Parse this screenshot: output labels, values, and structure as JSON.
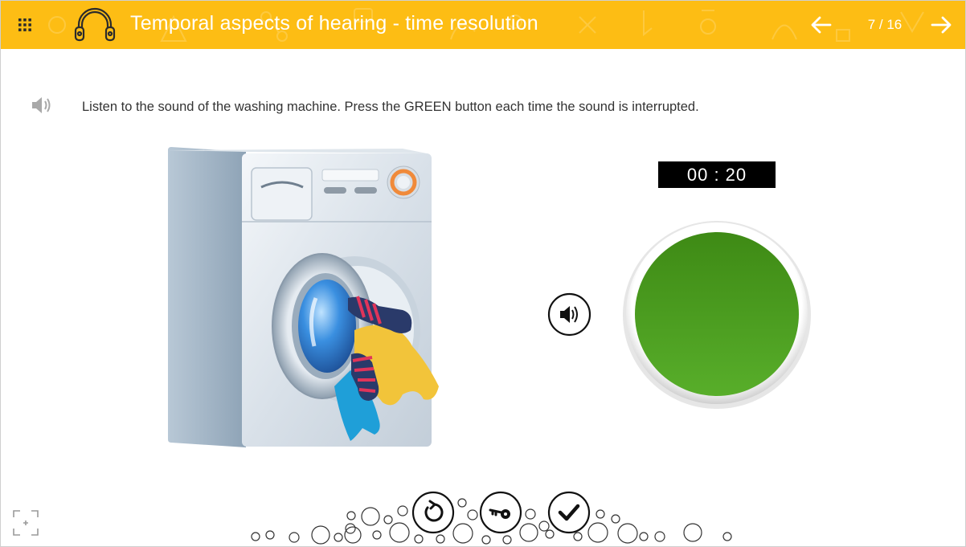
{
  "header": {
    "title": "Temporal aspects of hearing - time resolution",
    "page_indicator": "7 / 16",
    "background_color": "#fdbd14",
    "menu_icon": "grid-dots-icon",
    "logo_icon": "headphones-icon",
    "prev_icon": "arrow-left-icon",
    "next_icon": "arrow-right-icon"
  },
  "instruction": {
    "text": "Listen to the sound of the washing machine. Press the GREEN button each time the sound is interrupted.",
    "icon": "speaker-icon"
  },
  "exercise": {
    "timer": "00 : 20",
    "illustration": "washing-machine-illustration",
    "sound_button_icon": "speaker-icon",
    "response_button_color": "#4a9e1c"
  },
  "controls": {
    "reset_icon": "reset-icon",
    "key_icon": "key-icon",
    "check_icon": "check-icon",
    "fullscreen_icon": "fullscreen-icon"
  }
}
